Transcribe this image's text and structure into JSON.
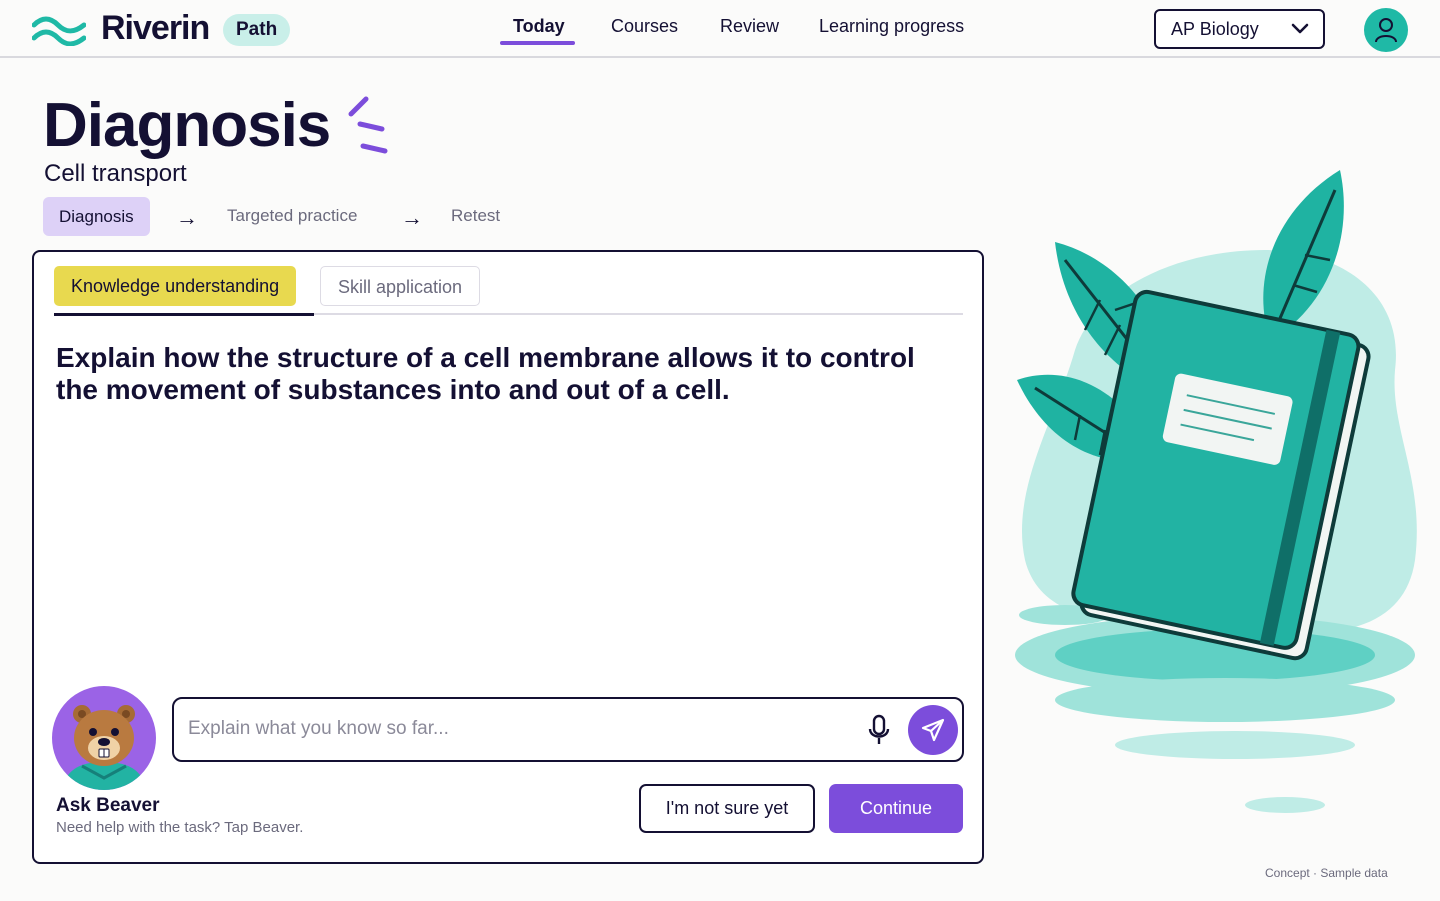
{
  "brand": {
    "name": "Riverin",
    "badge": "Path"
  },
  "nav": {
    "items": [
      {
        "label": "Today",
        "active": true
      },
      {
        "label": "Courses",
        "active": false
      },
      {
        "label": "Review",
        "active": false
      },
      {
        "label": "Learning progress",
        "active": false
      }
    ]
  },
  "course_select": {
    "value": "AP Biology"
  },
  "page": {
    "title": "Diagnosis",
    "subtitle": "Cell transport"
  },
  "steps": [
    "Diagnosis",
    "Targeted practice",
    "Retest"
  ],
  "step_separator": "→",
  "card": {
    "tabs": [
      {
        "label": "Knowledge understanding",
        "active": true
      },
      {
        "label": "Skill application",
        "active": false
      }
    ],
    "question": "Explain how the structure of a cell membrane allows it to control the movement of substances into and out of a cell.",
    "assistant": {
      "name": "Ask Beaver",
      "help": "Need help with the task? Tap Beaver."
    },
    "answer": {
      "placeholder": "Explain what you know so far...",
      "value": ""
    },
    "buttons": {
      "secondary": "I'm not sure yet",
      "primary": "Continue"
    }
  },
  "footer": {
    "note": "Concept · Sample data"
  },
  "icons": {
    "logo": "wave-logo-icon",
    "dropdown": "chevron-down-icon",
    "profile": "user-icon",
    "title_decoration": "sparkle-icon",
    "mic": "microphone-icon",
    "send": "send-icon",
    "assistant": "beaver-avatar-icon",
    "illustration": "notebook-leaves-illustration"
  },
  "colors": {
    "primary": "#7c4ddb",
    "accent_teal": "#1fb9a6",
    "active_tab": "#e8d94f",
    "active_step": "#ddd1f7",
    "text": "#141033"
  }
}
